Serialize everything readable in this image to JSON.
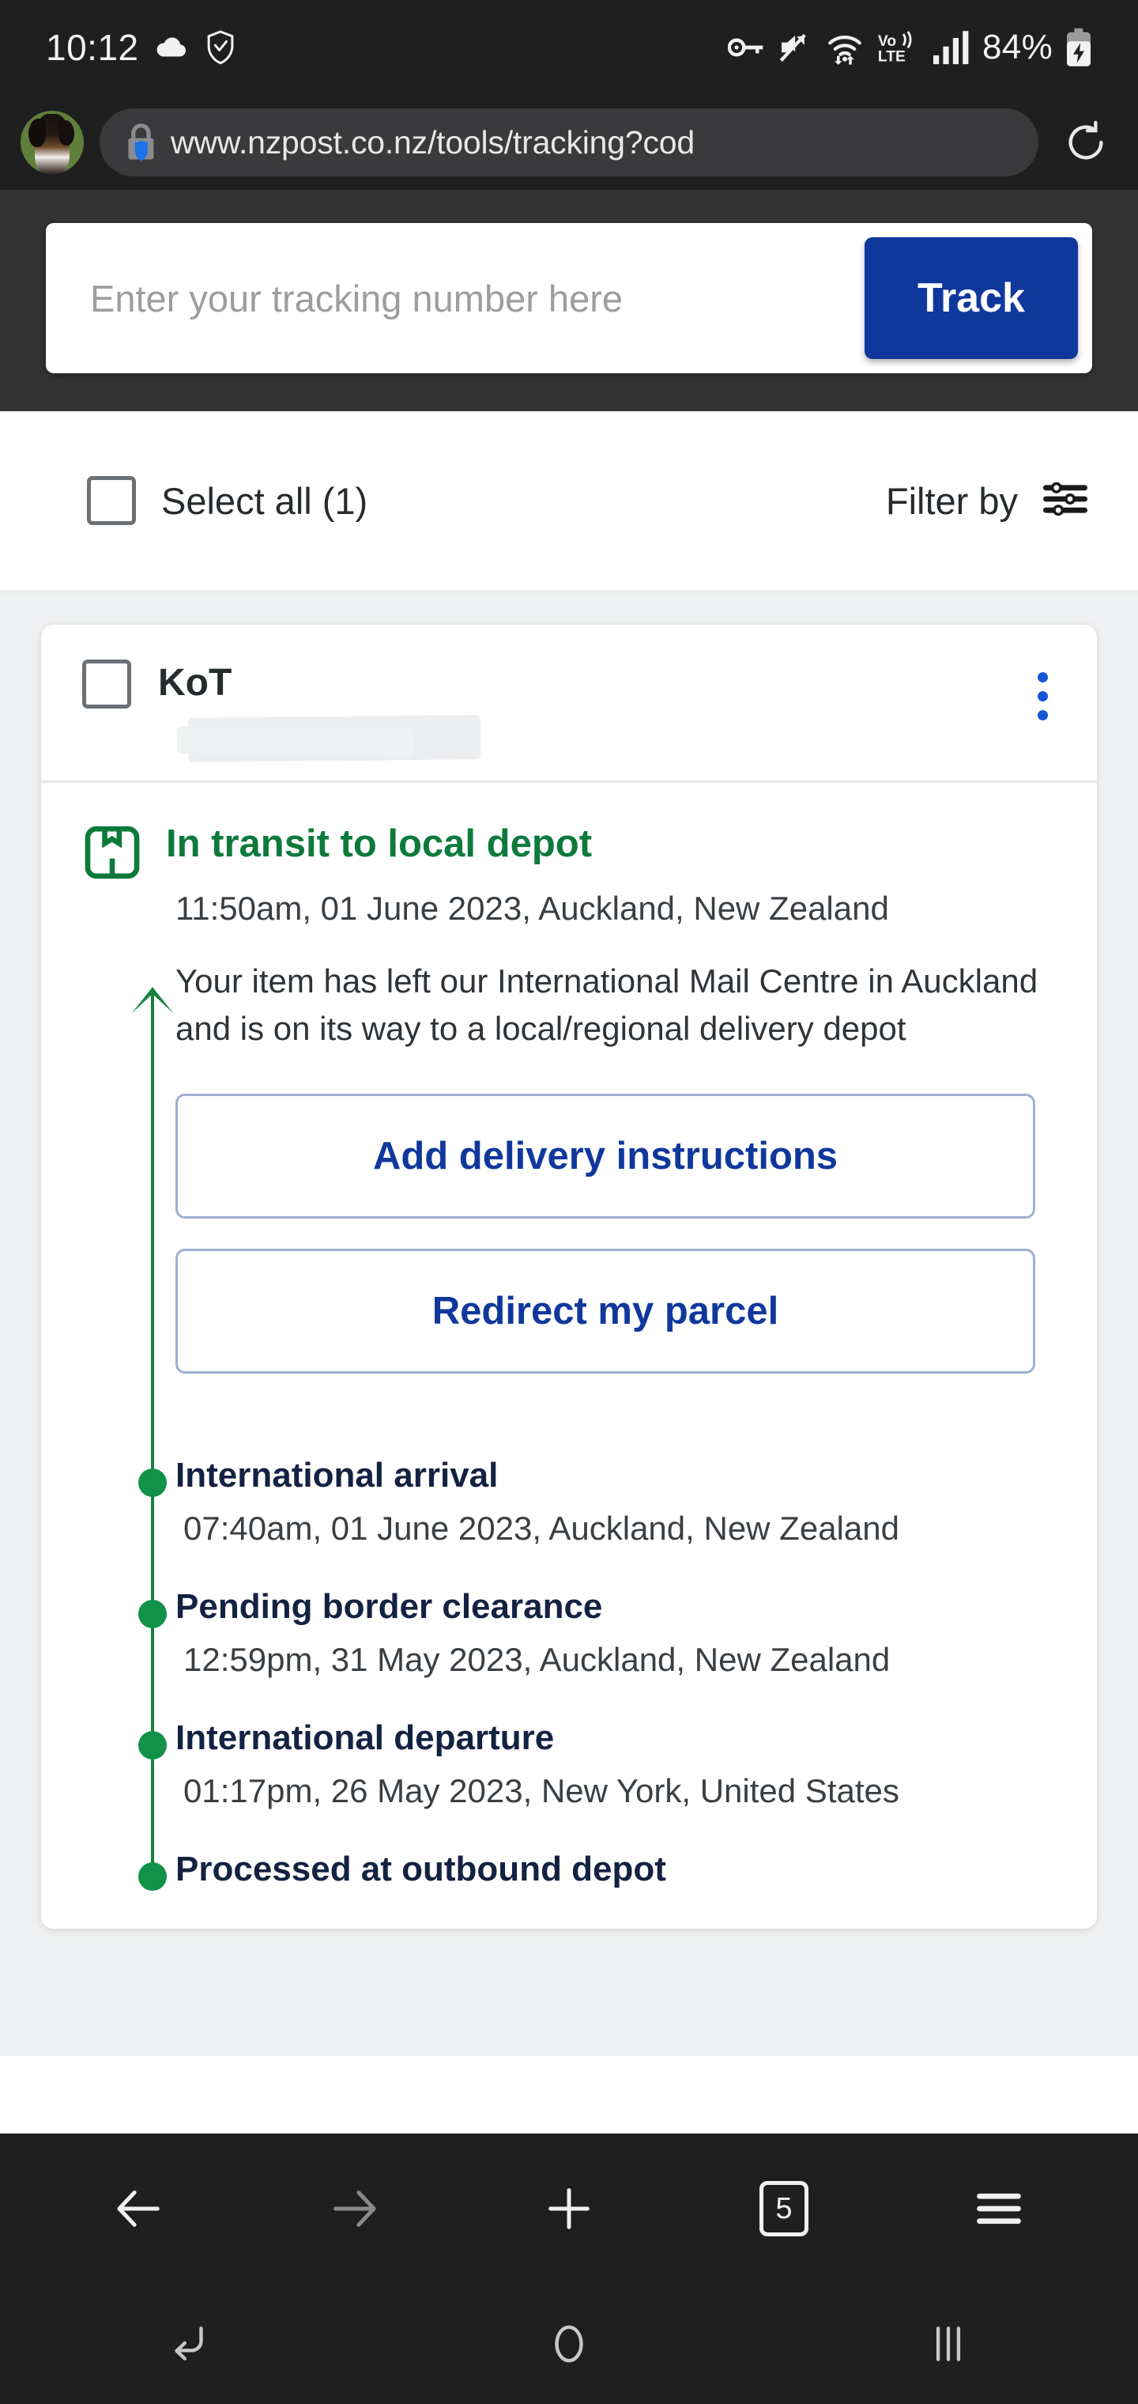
{
  "status_bar": {
    "time": "10:12",
    "battery_percent": "84%",
    "icons": [
      "cloud-icon",
      "shield-icon",
      "vpn-key-icon",
      "mute-icon",
      "wifi-icon",
      "volte-icon",
      "signal-icon",
      "battery-charging-icon"
    ]
  },
  "browser": {
    "url": "www.nzpost.co.nz/tools/tracking?cod",
    "avatar": "profile-avatar-dog",
    "lock_icon": "lock-icon",
    "reload_icon": "reload-icon",
    "bottom_nav": {
      "back": "back-arrow-icon",
      "forward": "forward-arrow-icon",
      "new_tab": "plus-icon",
      "tab_count": "5",
      "menu": "hamburger-menu-icon"
    }
  },
  "android_nav": {
    "back": "nav-back-icon",
    "home": "nav-home-icon",
    "recents": "nav-recents-icon"
  },
  "track_panel": {
    "placeholder": "Enter your tracking number here",
    "value": "",
    "button_label": "Track"
  },
  "filter_row": {
    "select_all_label": "Select all (1)",
    "filter_label": "Filter by",
    "filter_icon": "sliders-icon"
  },
  "parcel_card": {
    "title": "KoT",
    "tracking_number_redacted": "",
    "menu_icon": "kebab-menu-icon",
    "current_status": {
      "icon": "package-box-icon",
      "title": "In transit to local depot",
      "meta": "11:50am, 01 June 2023, Auckland, New Zealand",
      "description": "Your item has left our International Mail Centre in Auckland and is on its way to a local/regional delivery depot"
    },
    "actions": [
      {
        "label": "Add delivery instructions"
      },
      {
        "label": "Redirect my parcel"
      }
    ],
    "events": [
      {
        "title": "International arrival",
        "meta": "07:40am, 01 June 2023, Auckland, New Zealand"
      },
      {
        "title": "Pending border clearance",
        "meta": "12:59pm, 31 May 2023, Auckland, New Zealand"
      },
      {
        "title": "International departure",
        "meta": "01:17pm, 26 May 2023, New York, United States"
      },
      {
        "title": "Processed at outbound depot",
        "meta": ""
      }
    ]
  },
  "colors": {
    "brand_blue": "#10389c",
    "status_green": "#0d7a3c",
    "dot_green": "#119248",
    "event_title": "#142242",
    "chrome_dark": "#1f1f1f",
    "panel_dark": "#333333"
  }
}
